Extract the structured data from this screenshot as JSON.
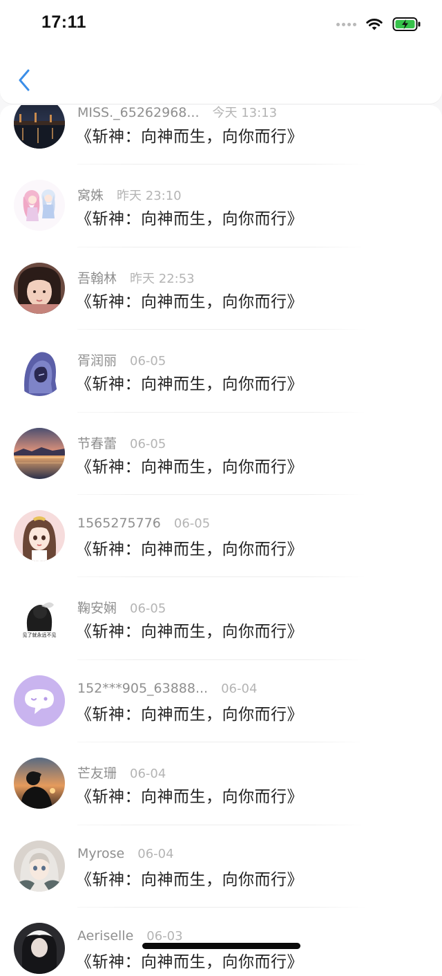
{
  "status_bar": {
    "time": "17:11",
    "battery_color": "#36c24a"
  },
  "nav": {
    "back_icon": "chevron-left-icon",
    "accent": "#3b8ee8"
  },
  "items": [
    {
      "name": "MISS._65262968...",
      "time": "今天 13:13",
      "message": "《斩神：向神而生，向你而行》",
      "avatar": "night-bridge"
    },
    {
      "name": "窝姝",
      "time": "昨天 23:10",
      "message": "《斩神：向神而生，向你而行》",
      "avatar": "anime-girls"
    },
    {
      "name": "吾翰林",
      "time": "昨天 22:53",
      "message": "《斩神：向神而生，向你而行》",
      "avatar": "girl-portrait"
    },
    {
      "name": "胥润丽",
      "time": "06-05",
      "message": "《斩神：向神而生，向你而行》",
      "avatar": "hooded-figure"
    },
    {
      "name": "节春蕾",
      "time": "06-05",
      "message": "《斩神：向神而生，向你而行》",
      "avatar": "sunset-sea"
    },
    {
      "name": "1565275776",
      "time": "06-05",
      "message": "《斩神：向神而生，向你而行》",
      "avatar": "cartoon-girl"
    },
    {
      "name": "鞠安娴",
      "time": "06-05",
      "message": "《斩神：向神而生，向你而行》",
      "avatar": "smoke-bw",
      "avatar_caption": "见了就永远不见"
    },
    {
      "name": "152***905_63888...",
      "time": "06-04",
      "message": "《斩神：向神而生，向你而行》",
      "avatar": "chat-bubble-purple"
    },
    {
      "name": "芒友珊",
      "time": "06-04",
      "message": "《斩神：向神而生，向你而行》",
      "avatar": "silhouette-sunset"
    },
    {
      "name": "Myrose",
      "time": "06-04",
      "message": "《斩神：向神而生，向你而行》",
      "avatar": "anime-white-hair"
    },
    {
      "name": "Aeriselle",
      "time": "06-03",
      "message": "《斩神：向神而生，向你而行》",
      "avatar": "dark-portrait"
    }
  ]
}
